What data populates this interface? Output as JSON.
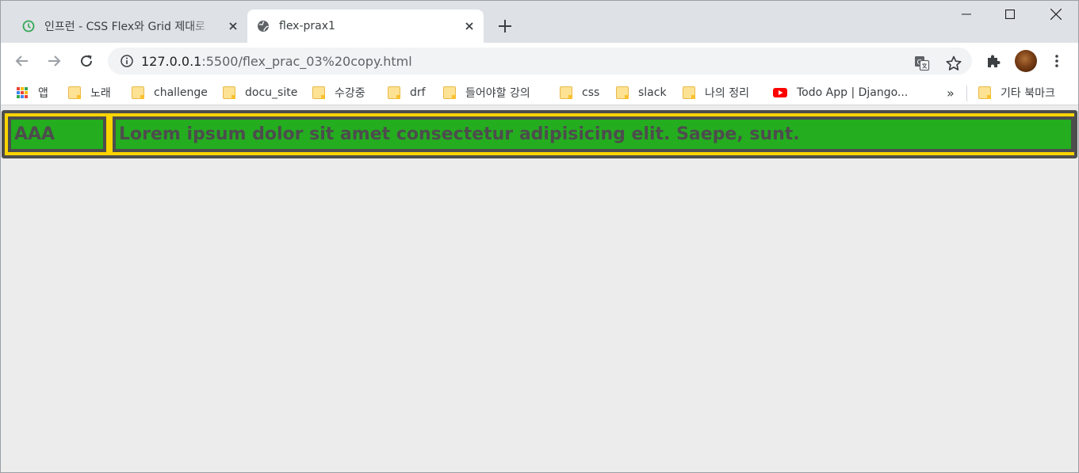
{
  "browser": {
    "tabs": [
      {
        "title": "인프런 - CSS Flex와 Grid 제대로 익히기",
        "favicon": "inflearn-icon",
        "active": false
      },
      {
        "title": "flex-prax1",
        "favicon": "globe-icon",
        "active": true
      }
    ],
    "url_host": "127.0.0.1",
    "url_rest": ":5500/flex_prac_03%20copy.html",
    "bookmarks": [
      {
        "label": "앱",
        "icon": "apps-grid-icon"
      },
      {
        "label": "노래",
        "icon": "folder-icon"
      },
      {
        "label": "challenge",
        "icon": "folder-icon"
      },
      {
        "label": "docu_site",
        "icon": "folder-icon"
      },
      {
        "label": "수강중",
        "icon": "folder-icon"
      },
      {
        "label": "drf",
        "icon": "folder-icon"
      },
      {
        "label": "들어야할 강의",
        "icon": "folder-icon"
      },
      {
        "label": "css",
        "icon": "folder-icon"
      },
      {
        "label": "slack",
        "icon": "folder-icon"
      },
      {
        "label": "나의 정리",
        "icon": "folder-icon"
      },
      {
        "label": "Todo App | Django...",
        "icon": "youtube-icon"
      }
    ],
    "bookmarks_overflow": "»",
    "other_bookmarks": "기타 북마크"
  },
  "page": {
    "items": [
      {
        "text": "AAA"
      },
      {
        "text": "Lorem ipsum dolor sit amet consectetur adipisicing elit. Saepe, sunt."
      }
    ]
  },
  "colors": {
    "container_bg": "#ffd400",
    "item_bg": "#24ad1f",
    "border": "#4d4d4d",
    "text": "#4d4d4d"
  }
}
